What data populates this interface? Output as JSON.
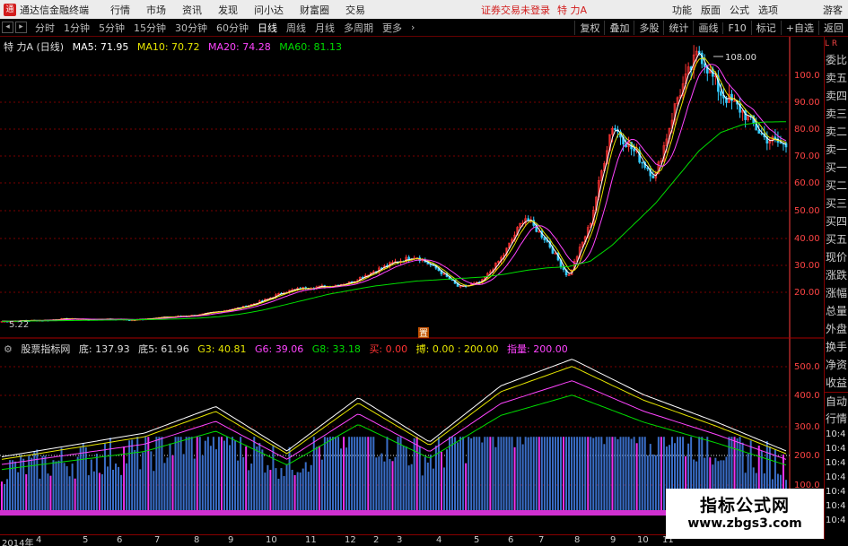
{
  "app": {
    "name": "通达信金融终端",
    "menu": [
      "行情",
      "市场",
      "资讯",
      "发现",
      "问小达",
      "财富圈",
      "交易"
    ],
    "alert": "证券交易未登录",
    "stock": "特 力A",
    "right_menu": [
      "功能",
      "版面",
      "公式",
      "选项"
    ],
    "guest": "游客"
  },
  "toolbar": {
    "periods": [
      "分时",
      "1分钟",
      "5分钟",
      "15分钟",
      "30分钟",
      "60分钟",
      "日线",
      "周线",
      "月线",
      "多周期",
      "更多"
    ],
    "active_period": "日线",
    "buttons": [
      "复权",
      "叠加",
      "多股",
      "统计",
      "画线",
      "F10",
      "标记",
      "+自选",
      "返回"
    ]
  },
  "main_legend": {
    "title": "特 力A (日线)",
    "ma5": "MA5: 71.95",
    "ma10": "MA10: 70.72",
    "ma20": "MA20: 74.28",
    "ma60": "MA60: 81.13"
  },
  "indicator_legend": {
    "name": "股票指标网",
    "di": "底: 137.93",
    "di5": "底5: 61.96",
    "g3": "G3: 40.81",
    "g6": "G6: 39.06",
    "g8": "G8: 33.18",
    "buy": "买: 0.00",
    "bo": "搏: 0.00 : 200.00",
    "zl": "指量: 200.00"
  },
  "colors": {
    "ma5": "#ffffff",
    "ma10": "#e5e500",
    "ma20": "#ff44ff",
    "ma60": "#00dd00",
    "up": "#ff3333",
    "down": "#33ccff",
    "grid": "#7a0000",
    "axis": "#ff3c3c",
    "bar_blue": "#3a6ec8",
    "bar_magenta": "#ee33ee"
  },
  "side_panel": {
    "head": "L  R",
    "items": [
      "委比",
      "卖五",
      "卖四",
      "卖三",
      "卖二",
      "卖一",
      "买一",
      "买二",
      "买三",
      "买四",
      "买五",
      "现价",
      "涨跌",
      "涨幅",
      "总量",
      "外盘",
      "换手",
      "净资",
      "收益",
      "自动",
      "行情"
    ],
    "times": [
      "10:4",
      "10:4",
      "10:4",
      "10:4",
      "10:4",
      "10:4",
      "10:4"
    ]
  },
  "price_axis": {
    "labels": [
      "100.0",
      "90.00",
      "80.00",
      "70.00",
      "60.00",
      "50.00",
      "40.00",
      "30.00",
      "20.00"
    ],
    "high_label": "108.00",
    "low_label": "5.22",
    "marker": "置"
  },
  "indicator_axis": {
    "labels": [
      "500.0",
      "400.0",
      "300.0",
      "200.0",
      "100.0"
    ]
  },
  "date_axis": {
    "labels": [
      "2014年",
      "4",
      "5",
      "6",
      "7",
      "8",
      "9",
      "10",
      "11",
      "12",
      "2",
      "3",
      "4",
      "5",
      "6",
      "7",
      "8",
      "9",
      "10",
      "11"
    ]
  },
  "watermark": {
    "line1": "指标公式网",
    "line2": "www.zbgs3.com"
  },
  "chart_data": {
    "type": "line",
    "price_close": [
      5.2,
      5.5,
      5.6,
      6.2,
      5.9,
      6.1,
      5.7,
      6.5,
      7.0,
      7.6,
      9.0,
      10.5,
      13.0,
      16.5,
      18.0,
      18.5,
      20.0,
      24.0,
      27.5,
      30.0,
      25.0,
      18.0,
      20.0,
      30.0,
      45.0,
      36.0,
      22.0,
      42.0,
      80.0,
      70.0,
      60.0,
      90.0,
      108.0,
      92.0,
      85.0,
      75.0,
      72.0
    ],
    "ma60": [
      5.2,
      5.3,
      5.4,
      5.5,
      5.6,
      5.7,
      5.8,
      5.9,
      6.1,
      6.4,
      7.0,
      8.0,
      9.5,
      11.5,
      13.5,
      15.5,
      17.0,
      18.5,
      19.5,
      20.5,
      21.0,
      21.5,
      22.0,
      23.0,
      24.5,
      25.5,
      26.0,
      28.0,
      34.0,
      42.0,
      50.0,
      60.0,
      70.0,
      77.0,
      80.0,
      81.0,
      81.1
    ],
    "indicator_peaks": [
      180,
      220,
      260,
      350,
      200,
      380,
      230,
      420,
      510,
      390,
      300,
      200
    ],
    "ylim_price": [
      5,
      110
    ],
    "ylim_indicator": [
      0,
      550
    ]
  }
}
